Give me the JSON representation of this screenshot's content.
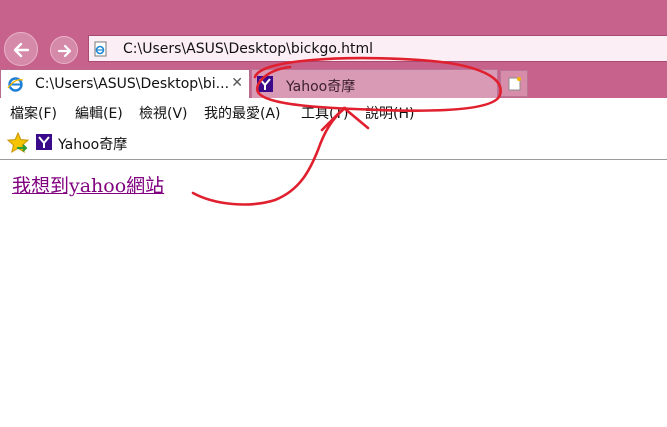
{
  "window": {
    "chrome_color": "#c7628c",
    "address_url": "C:\\Users\\ASUS\\Desktop\\bickgo.html"
  },
  "tabs": [
    {
      "label": "C:\\Users\\ASUS\\Desktop\\bi...",
      "close": "✕",
      "icon": "ie-icon",
      "active": true
    },
    {
      "label": "Yahoo奇摩",
      "icon": "yahoo-icon",
      "active": false
    }
  ],
  "menu": {
    "items": [
      "檔案(F)",
      "編輯(E)",
      "檢視(V)",
      "我的最愛(A)",
      "工具(T)",
      "說明(H)"
    ]
  },
  "favorites": {
    "items": [
      {
        "label": "Yahoo奇摩",
        "icon": "yahoo-icon"
      }
    ]
  },
  "content": {
    "link_text": "我想到yahoo網站",
    "link_color": "#800080"
  },
  "annotation": {
    "color": "#e0202e"
  }
}
